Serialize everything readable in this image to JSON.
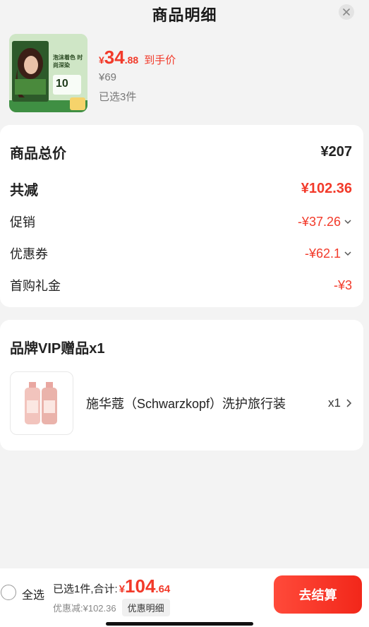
{
  "header": {
    "title": "商品明细"
  },
  "product": {
    "image_text": {
      "headline": "泡沫着色 时尚深染",
      "badge": "10"
    },
    "final_price": {
      "currency": "¥",
      "integer": "34",
      "decimal": ".88",
      "label": "到手价"
    },
    "original_price": "¥69",
    "selected_count": "已选3件"
  },
  "summary": {
    "total_label": "商品总价",
    "total_value": "¥207",
    "reduce_label": "共减",
    "reduce_value": "¥102.36",
    "promo_label": "促销",
    "promo_value": "-¥37.26",
    "coupon_label": "优惠券",
    "coupon_value": "-¥62.1",
    "gift_money_label": "首购礼金",
    "gift_money_value": "-¥3"
  },
  "gift": {
    "title": "品牌VIP赠品x1",
    "item_name": "施华蔻（Schwarzkopf）洗护旅行装",
    "item_qty": "x1"
  },
  "bottom_bar": {
    "select_all": "全选",
    "sum_label": "已选1件,合计:",
    "sum_currency": "¥",
    "sum_integer": "104",
    "sum_decimal": ".64",
    "discount_text": "优惠减:¥102.36",
    "detail_button": "优惠明细",
    "checkout_button": "去结算"
  },
  "colors": {
    "accent": "#f23a2a",
    "background": "#f3f3f3",
    "card": "#ffffff"
  }
}
